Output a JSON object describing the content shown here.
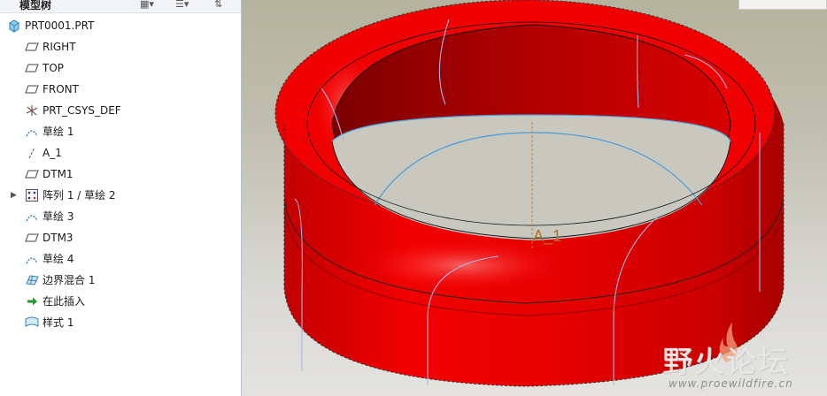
{
  "model_tree": {
    "title": "模型树",
    "root": "PRT0001.PRT",
    "items": [
      {
        "label": "RIGHT",
        "icon": "datum-plane-icon"
      },
      {
        "label": "TOP",
        "icon": "datum-plane-icon"
      },
      {
        "label": "FRONT",
        "icon": "datum-plane-icon"
      },
      {
        "label": "PRT_CSYS_DEF",
        "icon": "coordinate-system-icon"
      },
      {
        "label": "草绘 1",
        "icon": "sketch-icon"
      },
      {
        "label": "A_1",
        "icon": "datum-axis-icon"
      },
      {
        "label": "DTM1",
        "icon": "datum-plane-icon"
      },
      {
        "label": "阵列 1 / 草绘 2",
        "icon": "pattern-icon"
      },
      {
        "label": "草绘 3",
        "icon": "sketch-icon"
      },
      {
        "label": "DTM3",
        "icon": "datum-plane-icon"
      },
      {
        "label": "草绘 4",
        "icon": "sketch-icon"
      },
      {
        "label": "边界混合 1",
        "icon": "boundary-blend-icon"
      },
      {
        "label": "在此插入",
        "icon": "insert-here-arrow-icon"
      },
      {
        "label": "样式 1",
        "icon": "style-icon"
      }
    ]
  },
  "viewport": {
    "axis_label": "A_1",
    "watermark_text": "野火论坛",
    "watermark_url": "www.proewildfire.cn",
    "model_color": "#ee0000",
    "background_top": "#b4b39d",
    "background_bottom": "#e4e3e0"
  }
}
